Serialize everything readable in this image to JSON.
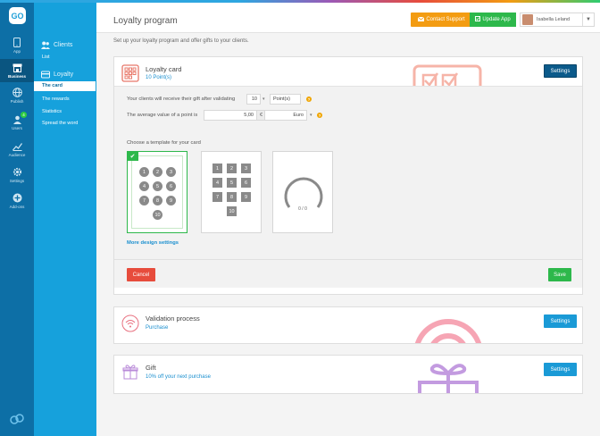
{
  "header": {
    "title": "Loyalty program",
    "contact_label": "Contact Support",
    "update_label": "Update App",
    "user_name": "Isabella Leland"
  },
  "subtitle": "Set up your loyalty program and offer gifts to your clients.",
  "rail": {
    "items": [
      {
        "label": "App",
        "icon": "phone-icon"
      },
      {
        "label": "Business",
        "icon": "store-icon"
      },
      {
        "label": "Publish",
        "icon": "globe-icon"
      },
      {
        "label": "Users",
        "icon": "users-icon",
        "badge": "4"
      },
      {
        "label": "Audience",
        "icon": "chart-icon"
      },
      {
        "label": "Settings",
        "icon": "gear-icon"
      },
      {
        "label": "Add-ons",
        "icon": "plus-icon"
      }
    ]
  },
  "subnav": {
    "clients_head": "Clients",
    "clients_list": "List",
    "loyalty_head": "Loyalty",
    "links": [
      "The card",
      "The rewards",
      "Statistics",
      "Spread the word"
    ]
  },
  "loyalty_card": {
    "title": "Loyalty card",
    "points": "10 Point(s)",
    "settings_label": "Settings",
    "row1_label": "Your clients will receive their gift after validating",
    "row1_value": "10",
    "row1_unit": "Point(s)",
    "row2_label": "The average value of a point is",
    "row2_value": "5,00",
    "row2_currency_symbol": "€",
    "row2_currency": "Euro",
    "template_label": "Choose a template for your card",
    "numbers": [
      "1",
      "2",
      "3",
      "4",
      "5",
      "6",
      "7",
      "8",
      "9",
      "10"
    ],
    "progress_text": "0 / 0",
    "more_design": "More design settings",
    "cancel_label": "Cancel",
    "save_label": "Save"
  },
  "validation": {
    "title": "Validation process",
    "sub": "Purchase",
    "settings_label": "Settings"
  },
  "gift": {
    "title": "Gift",
    "sub": "10% off your next purchase",
    "settings_label": "Settings"
  },
  "colors": {
    "rail": "#0d6fa6",
    "subnav": "#16a1dc",
    "accent_orange": "#f39c12",
    "accent_green": "#2db84b",
    "accent_red": "#e74c3c",
    "link_blue": "#1a8fcf"
  }
}
